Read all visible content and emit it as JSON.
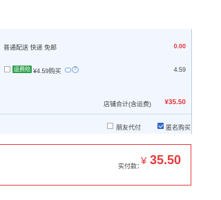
{
  "shipping": {
    "label": "普通配送 快递 免邮",
    "price": "0.00"
  },
  "insurance": {
    "tag": "运费险",
    "label": "¥4.59购买",
    "price": "4.59"
  },
  "store_total": {
    "label": "店铺合计(含运费)",
    "amount": "¥35.50"
  },
  "options": {
    "friend_pay": "朋友代付",
    "anonymous": "匿名购买",
    "anonymous_checked": true
  },
  "payment": {
    "label": "实付款：",
    "currency": "¥",
    "amount": "35.50"
  }
}
